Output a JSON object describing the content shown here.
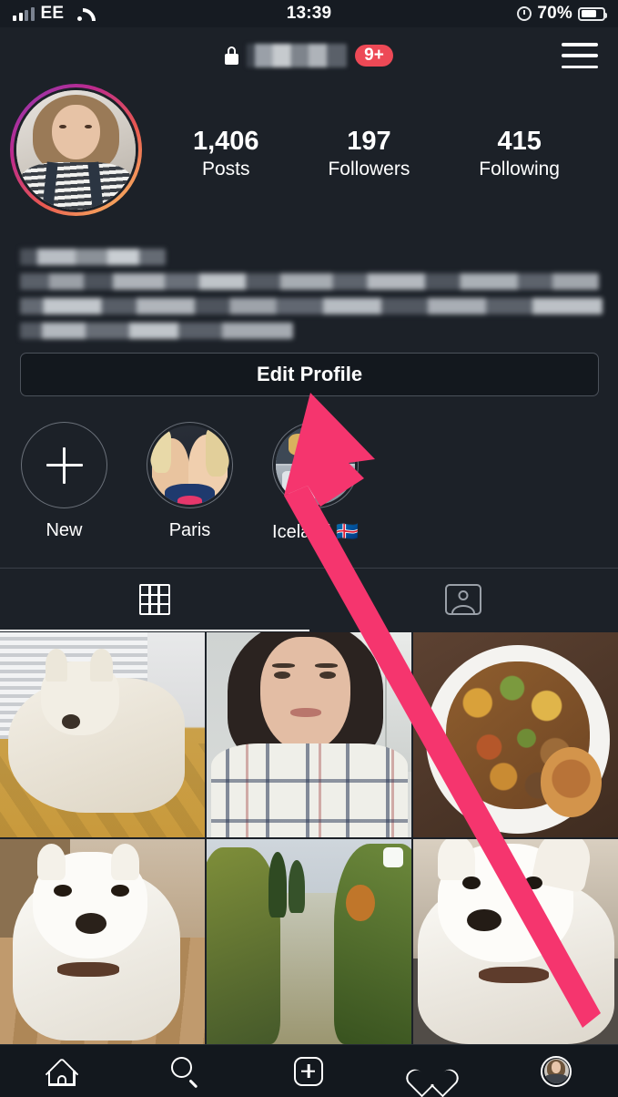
{
  "status_bar": {
    "carrier": "EE",
    "time": "13:39",
    "battery_percent": "70%",
    "signal_icon": "signal-bars-icon",
    "wifi_icon": "wifi-icon",
    "alarm_icon": "alarm-clock-icon",
    "battery_icon": "battery-icon"
  },
  "top_nav": {
    "lock_icon": "padlock-icon",
    "username": "",
    "username_redacted": true,
    "notification_badge": "9+",
    "menu_icon": "hamburger-menu-icon",
    "badge_color": "#ed4956"
  },
  "profile": {
    "avatar_name": "profile-avatar",
    "has_story_ring": true,
    "stats": [
      {
        "value": "1,406",
        "label": "Posts"
      },
      {
        "value": "197",
        "label": "Followers"
      },
      {
        "value": "415",
        "label": "Following"
      }
    ],
    "bio_redacted": true,
    "edit_profile_label": "Edit Profile"
  },
  "highlights": [
    {
      "label": "New",
      "type": "add"
    },
    {
      "label": "Paris",
      "type": "thumb"
    },
    {
      "label": "Iceland 🇮🇸",
      "type": "thumb"
    }
  ],
  "tabs": [
    {
      "name": "grid",
      "icon": "grid-icon",
      "active": true
    },
    {
      "name": "tagged",
      "icon": "tagged-person-icon",
      "active": false
    }
  ],
  "grid_posts": [
    {
      "alt": "white terrier dog lying on mustard cushion by window blinds",
      "carousel": false
    },
    {
      "alt": "selfie of woman with dark hair in plaid shirt in kitchen",
      "carousel": false
    },
    {
      "alt": "roast dinner plate with vegetables and yorkshire pudding",
      "carousel": false
    },
    {
      "alt": "white dog standing on wooden floor",
      "carousel": false
    },
    {
      "alt": "river with autumn trees on both banks",
      "carousel": true
    },
    {
      "alt": "close up of white west highland terrier",
      "carousel": false
    }
  ],
  "bottom_nav": [
    {
      "name": "home",
      "icon": "home-icon",
      "active": false
    },
    {
      "name": "search",
      "icon": "search-icon",
      "active": false
    },
    {
      "name": "create",
      "icon": "plus-square-icon",
      "active": false
    },
    {
      "name": "activity",
      "icon": "heart-icon",
      "active": false
    },
    {
      "name": "profile",
      "icon": "profile-avatar-icon",
      "active": true
    }
  ],
  "annotation": {
    "type": "arrow",
    "color": "#f5356e",
    "points_to": "Edit Profile"
  }
}
